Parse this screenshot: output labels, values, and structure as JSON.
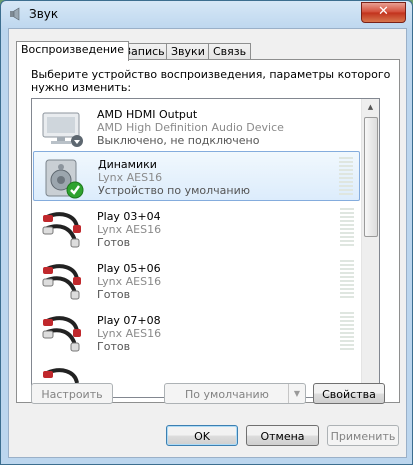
{
  "window": {
    "title": "Звук",
    "close_glyph": "✕"
  },
  "tabs": [
    {
      "label": "Воспроизведение",
      "active": true
    },
    {
      "label": "Запись",
      "active": false
    },
    {
      "label": "Звуки",
      "active": false
    },
    {
      "label": "Связь",
      "active": false
    }
  ],
  "description": "Выберите устройство воспроизведения, параметры которого нужно изменить:",
  "devices": [
    {
      "name": "AMD HDMI Output",
      "subtitle": "AMD High Definition Audio Device",
      "status": "Выключено, не подключено",
      "icon": "monitor-icon",
      "selected": false
    },
    {
      "name": "Динамики",
      "subtitle": "Lynx AES16",
      "status": "Устройство по умолчанию",
      "icon": "speaker-icon",
      "selected": true
    },
    {
      "name": "Play 03+04",
      "subtitle": "Lynx AES16",
      "status": "Готов",
      "icon": "rca-cable-icon",
      "selected": false
    },
    {
      "name": "Play 05+06",
      "subtitle": "Lynx AES16",
      "status": "Готов",
      "icon": "rca-cable-icon",
      "selected": false
    },
    {
      "name": "Play 07+08",
      "subtitle": "Lynx AES16",
      "status": "Готов",
      "icon": "rca-cable-icon",
      "selected": false
    }
  ],
  "buttons": {
    "configure": "Настроить",
    "set_default": "По умолчанию",
    "properties": "Свойства",
    "ok": "OK",
    "cancel": "Отмена",
    "apply": "Применить"
  },
  "colors": {
    "selection_border": "#84acdd",
    "check_green": "#2fa32f",
    "cable_red": "#c0282c"
  }
}
